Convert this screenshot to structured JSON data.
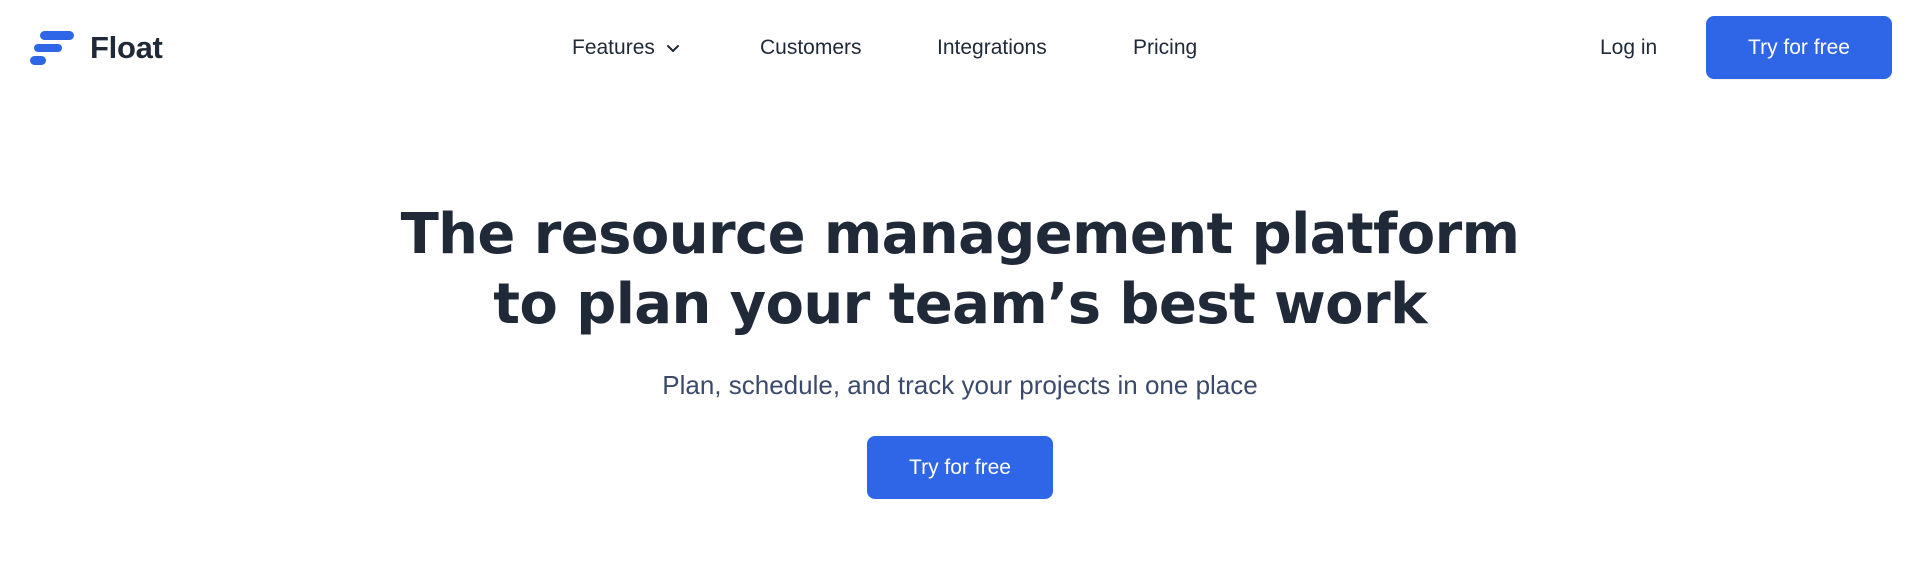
{
  "brand": {
    "name": "Float",
    "logo_icon": "float-logo-icon",
    "accent_color": "#2f66e8",
    "text_color": "#1f2937"
  },
  "nav": {
    "items": [
      {
        "label": "Features",
        "has_dropdown": true,
        "icon": "chevron-down-icon"
      },
      {
        "label": "Customers"
      },
      {
        "label": "Integrations"
      },
      {
        "label": "Pricing"
      }
    ]
  },
  "header": {
    "login_label": "Log in",
    "cta_label": "Try for free"
  },
  "hero": {
    "title_line1": "The resource management platform",
    "title_line2": "to plan your team’s best work",
    "subtitle": "Plan, schedule, and track your projects in one place",
    "cta_label": "Try for free"
  }
}
